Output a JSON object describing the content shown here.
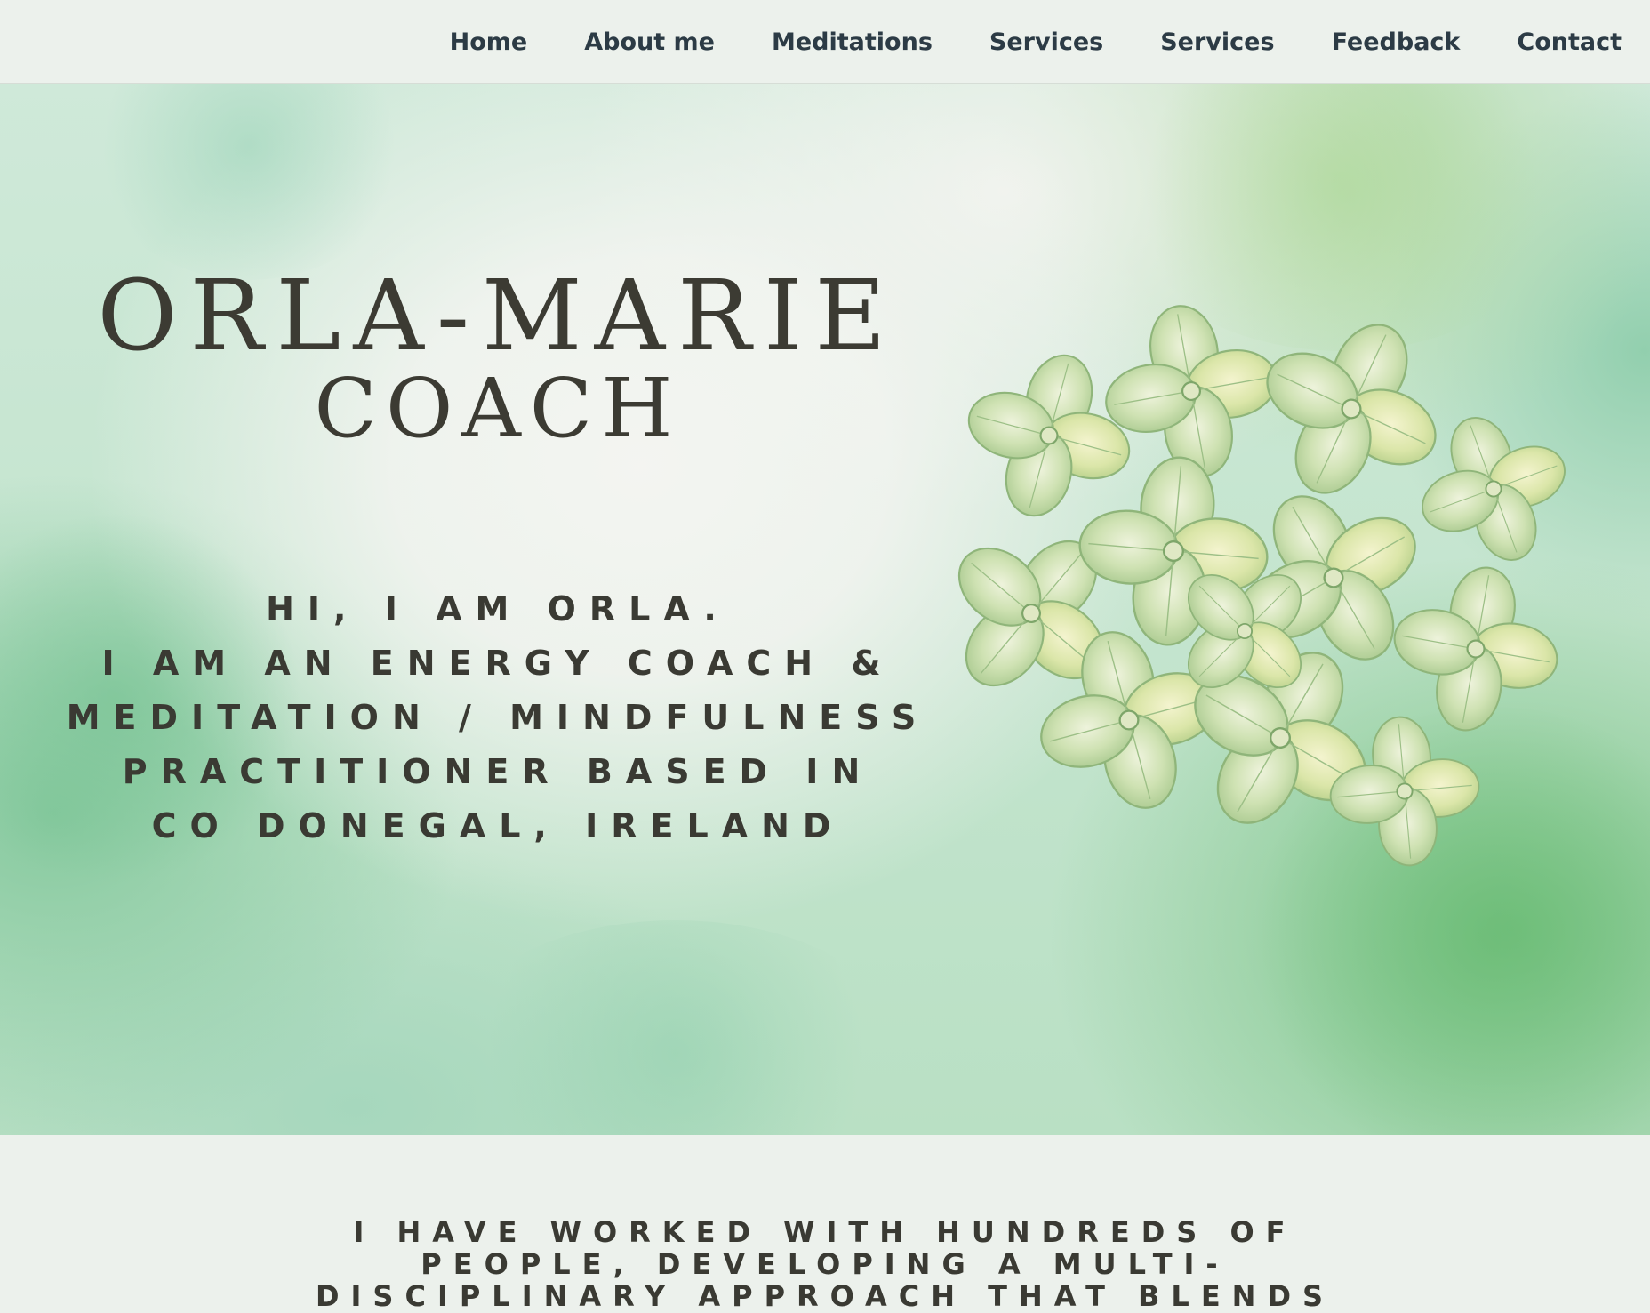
{
  "nav": {
    "items": [
      {
        "label": "Home"
      },
      {
        "label": "About me"
      },
      {
        "label": "Meditations"
      },
      {
        "label": "Services"
      },
      {
        "label": "Services"
      },
      {
        "label": "Feedback"
      },
      {
        "label": "Contact"
      }
    ]
  },
  "hero": {
    "title_line1": "ORLA-MARIE",
    "title_line2": "COACH",
    "intro": "HI, I AM ORLA.\nI AM AN  ENERGY COACH &\nMEDITATION / MINDFULNESS\nPRACTITIONER BASED IN\nCO DONEGAL, IRELAND",
    "image_icon": "hydrangea-flower"
  },
  "about": {
    "text": "I HAVE WORKED WITH HUNDREDS OF\nPEOPLE, DEVELOPING A MULTI-\nDISCIPLINARY APPROACH THAT BLENDS"
  },
  "colors": {
    "page_bg": "#ecf1ec",
    "nav_text": "#2c3b45",
    "heading_text": "#3c3b33",
    "watercolor_green": "#7cc487",
    "watercolor_teal": "#92cfae"
  }
}
